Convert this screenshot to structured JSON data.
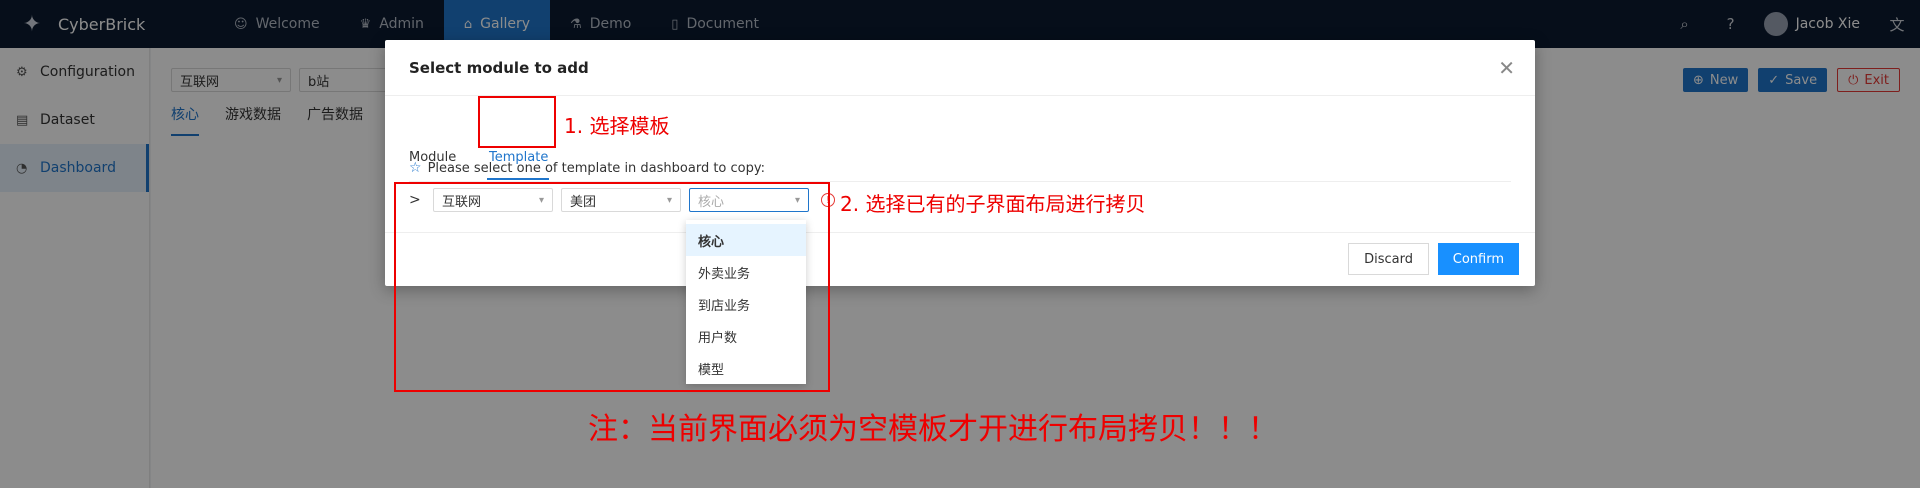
{
  "brand": {
    "name": "CyberBrick"
  },
  "nav": [
    {
      "label": "Welcome",
      "icon": "smile-icon",
      "active": false
    },
    {
      "label": "Admin",
      "icon": "crown-icon",
      "active": false
    },
    {
      "label": "Gallery",
      "icon": "bank-icon",
      "active": true
    },
    {
      "label": "Demo",
      "icon": "flask-icon",
      "active": false
    },
    {
      "label": "Document",
      "icon": "book-icon",
      "active": false
    }
  ],
  "topright": {
    "user": "Jacob Xie"
  },
  "sidebar": [
    {
      "label": "Configuration",
      "icon": "gear-icon"
    },
    {
      "label": "Dataset",
      "icon": "database-icon"
    },
    {
      "label": "Dashboard",
      "icon": "dashboard-icon"
    }
  ],
  "main": {
    "filters": [
      "互联网",
      "b站"
    ],
    "tabs": [
      "核心",
      "游戏数据",
      "广告数据"
    ],
    "actions": {
      "new": "New",
      "save": "Save",
      "exit": "Exit"
    }
  },
  "modal": {
    "title": "Select module to add",
    "tabs": [
      "Module",
      "Template"
    ],
    "hint": "Please select one of template in dashboard to copy:",
    "selects": [
      "互联网",
      "美团"
    ],
    "third_placeholder": "核心",
    "options": [
      "核心",
      "外卖业务",
      "到店业务",
      "用户数",
      "模型"
    ],
    "discard": "Discard",
    "confirm": "Confirm"
  },
  "annotations": {
    "step1": "1. 选择模板",
    "step2": "2. 选择已有的子界面布局进行拷贝",
    "note": "注：当前界面必须为空模板才开进行布局拷贝！！！"
  },
  "colors": {
    "nav_bg": "#0b1a30",
    "accent": "#1f75cb",
    "confirm": "#1890ff",
    "annotation": "#ee0000"
  }
}
